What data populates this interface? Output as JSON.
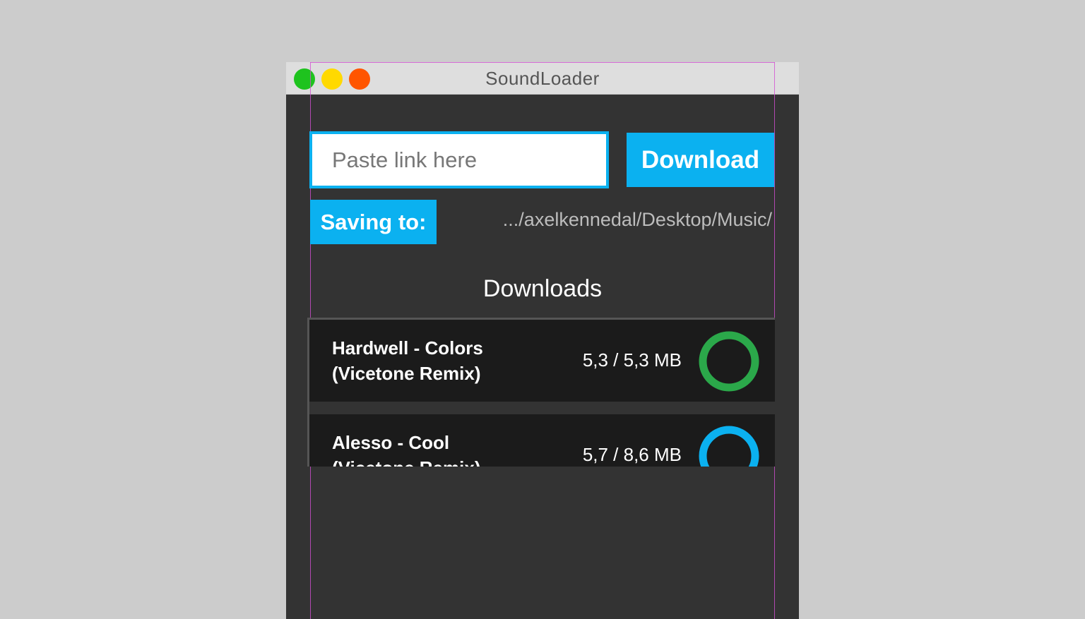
{
  "window": {
    "title": "SoundLoader",
    "controls": {
      "green": "#1ec31e",
      "yellow": "#ffd900",
      "red": "#ff5500"
    }
  },
  "link_input": {
    "placeholder": "Paste link here",
    "value": ""
  },
  "download_button": {
    "label": "Download"
  },
  "saving": {
    "label": "Saving to:",
    "path": ".../axelkennedal/Desktop/Music/"
  },
  "downloads": {
    "title": "Downloads",
    "items": [
      {
        "name": "Hardwell - Colors (Vicetone Remix)",
        "size": "5,3 / 5,3 MB",
        "progress": 1.0,
        "status_color": "#2ba84a"
      },
      {
        "name": "Alesso - Cool (Vicetone Remix)",
        "size": "5,7 / 8,6 MB",
        "progress": 0.66,
        "status_color": "#0bb1f0"
      }
    ]
  },
  "colors": {
    "accent": "#0bb1f0",
    "background": "#333333",
    "item_background": "#1b1b1b"
  }
}
